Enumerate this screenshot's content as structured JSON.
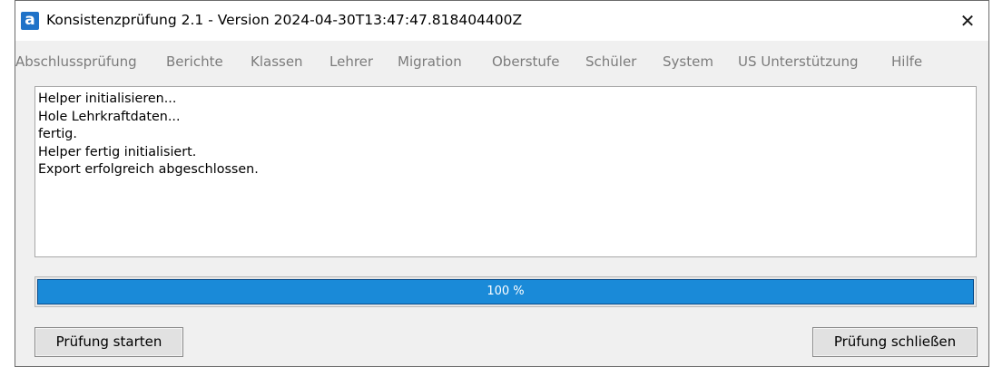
{
  "window": {
    "title": "Konsistenzprüfung 2.1 - Version 2024-04-30T13:47:47.818404400Z",
    "app_icon_letter": "a",
    "close_glyph": "✕"
  },
  "menu": {
    "items": [
      "Abschlussprüfung",
      "Berichte",
      "Klassen",
      "Lehrer",
      "Migration",
      "Oberstufe",
      "Schüler",
      "System",
      "US Unterstützung",
      "Hilfe"
    ]
  },
  "log": {
    "lines": [
      "Helper initialisieren...",
      "Hole Lehrkraftdaten...",
      "fertig.",
      "Helper fertig initialisiert.",
      "Export erfolgreich abgeschlossen."
    ]
  },
  "progress": {
    "value_fraction": 1.0,
    "label": "100 %",
    "fill_color": "#1a8ad8"
  },
  "buttons": {
    "start_label": "Prüfung starten",
    "close_label": "Prüfung schließen"
  }
}
